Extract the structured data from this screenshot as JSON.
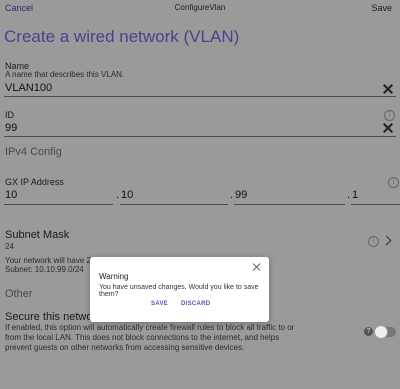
{
  "nav": {
    "cancel": "Cancel",
    "title": "ConfigureVlan",
    "save": "Save"
  },
  "page_title": "Create a wired network (VLAN)",
  "name_field": {
    "label": "Name",
    "description": "A name that describes this VLAN.",
    "value": "VLAN100"
  },
  "id_field": {
    "label": "ID",
    "value": "99"
  },
  "ipv4_section": "IPv4 Config",
  "gx_ip": {
    "label": "GX IP Address",
    "octets": [
      "10",
      "10",
      "99",
      "1"
    ],
    "dot": "."
  },
  "subnet": {
    "label": "Subnet Mask",
    "value": "24"
  },
  "network_info": {
    "line1": "Your network will have 2",
    "line2": "Subnet: 10.10.99.0/24"
  },
  "other_section": "Other",
  "secure": {
    "title": "Secure this network",
    "desc1": "If enabled, this option will automatically create firewall rules to block all traffic to or",
    "desc2": "from the local LAN. This does not block connections to the internet, and helps",
    "desc3": "prevent guests on other networks from accessing sensitive devices.",
    "enabled": false
  },
  "dialog": {
    "title": "Warning",
    "message": "You have unsaved changes. Would you like to save them?",
    "save": "SAVE",
    "discard": "DISCARD"
  },
  "icons": {
    "info": "i",
    "help": "?"
  }
}
